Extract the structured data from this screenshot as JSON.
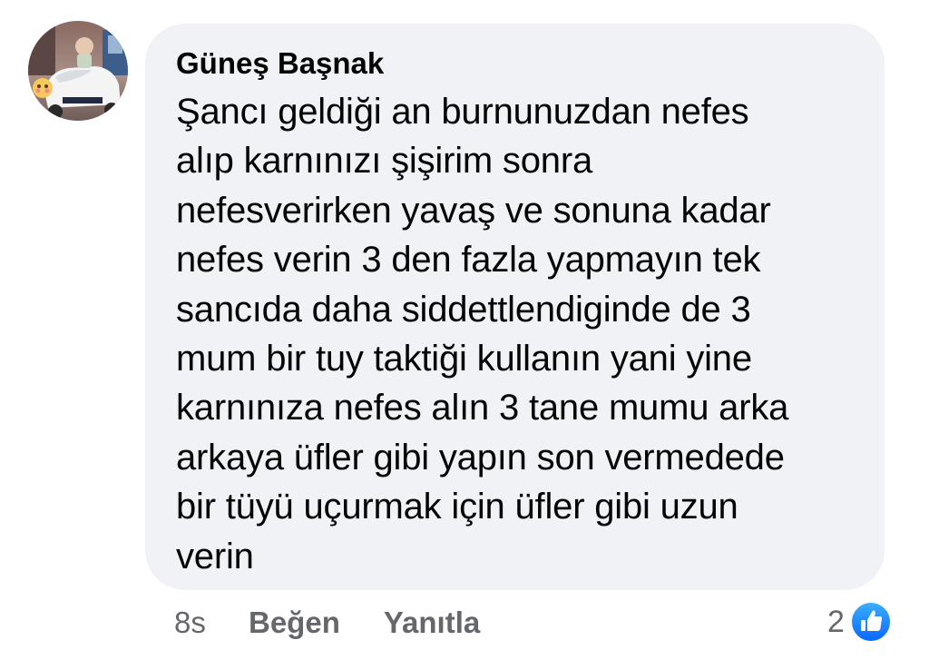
{
  "comment": {
    "author": "Güneş Başnak",
    "text": "Şancı geldiği an burnunuzdan nefes\nalıp karnınızı şişirim sonra\nnefesverirken yavaş  ve sonuna kadar\nnefes verin 3 den fazla yapmayın tek\nsancıda  daha siddettlendiginde de 3\nmum bir tuy taktiği kullanın yani yine\nkarnınıza nefes alın 3 tane mumu arka\narkaya üfler gibi yapın son vermedede\nbir tüyü  uçurmak için üfler gibi uzun\nverin",
    "timestamp": "8s",
    "like_label": "Beğen",
    "reply_label": "Yanıtla",
    "reaction_count": "2",
    "reaction_icon": "thumbs-up-icon"
  },
  "colors": {
    "bubble": "#f0f2f5",
    "text": "#050505",
    "muted": "#65676b",
    "like_blue_light": "#3cb0ff",
    "like_blue_dark": "#0866ff"
  }
}
